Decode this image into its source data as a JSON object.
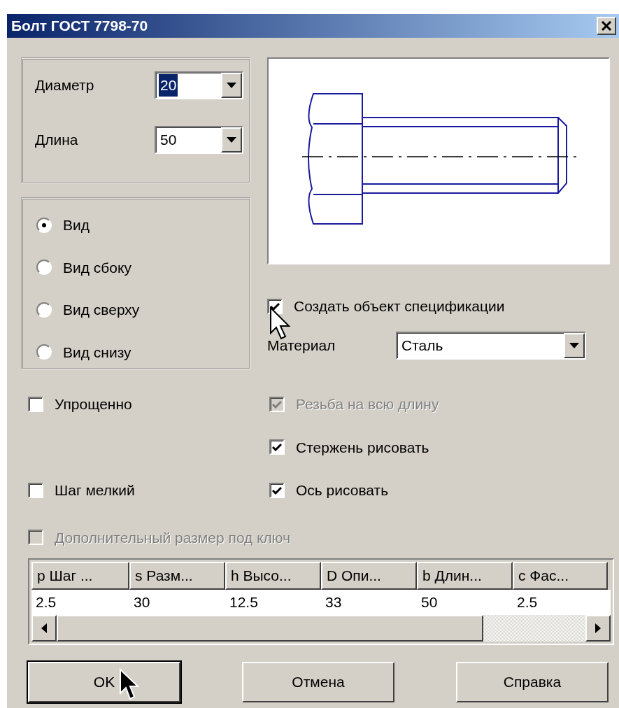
{
  "window": {
    "title": "Болт ГОСТ 7798-70"
  },
  "size_fields": [
    {
      "label": "Диаметр",
      "value": "20",
      "selected": true
    },
    {
      "label": "Длина",
      "value": "50",
      "selected": false
    }
  ],
  "view_options": [
    {
      "label": "Вид",
      "selected": true
    },
    {
      "label": "Вид сбоку",
      "selected": false
    },
    {
      "label": "Вид сверху",
      "selected": false
    },
    {
      "label": "Вид снизу",
      "selected": false
    }
  ],
  "create_spec": {
    "label": "Создать объект спецификации",
    "checked": true,
    "disabled": false
  },
  "material": {
    "label": "Материал",
    "value": "Сталь"
  },
  "left_options": [
    {
      "label": "Упрощенно",
      "checked": false,
      "disabled": false
    },
    {
      "label": "Шаг мелкий",
      "checked": false,
      "disabled": false
    }
  ],
  "right_options": [
    {
      "label": "Резьба на всю длину",
      "checked": true,
      "disabled": true
    },
    {
      "label": "Стержень рисовать",
      "checked": true,
      "disabled": false
    },
    {
      "label": "Ось рисовать",
      "checked": true,
      "disabled": false
    }
  ],
  "extra_option": {
    "label": "Дополнительный размер под ключ",
    "checked": false,
    "disabled": true
  },
  "table": {
    "columns": [
      "p Шаг ...",
      "s Разм...",
      "h Высо...",
      "D Опи...",
      "b Длин...",
      "c Фас..."
    ],
    "rows": [
      [
        "2.5",
        "30",
        "12.5",
        "33",
        "50",
        "2.5"
      ]
    ]
  },
  "buttons": [
    {
      "label": "OK",
      "default": true
    },
    {
      "label": "Отмена",
      "default": false
    },
    {
      "label": "Справка",
      "default": false
    }
  ]
}
